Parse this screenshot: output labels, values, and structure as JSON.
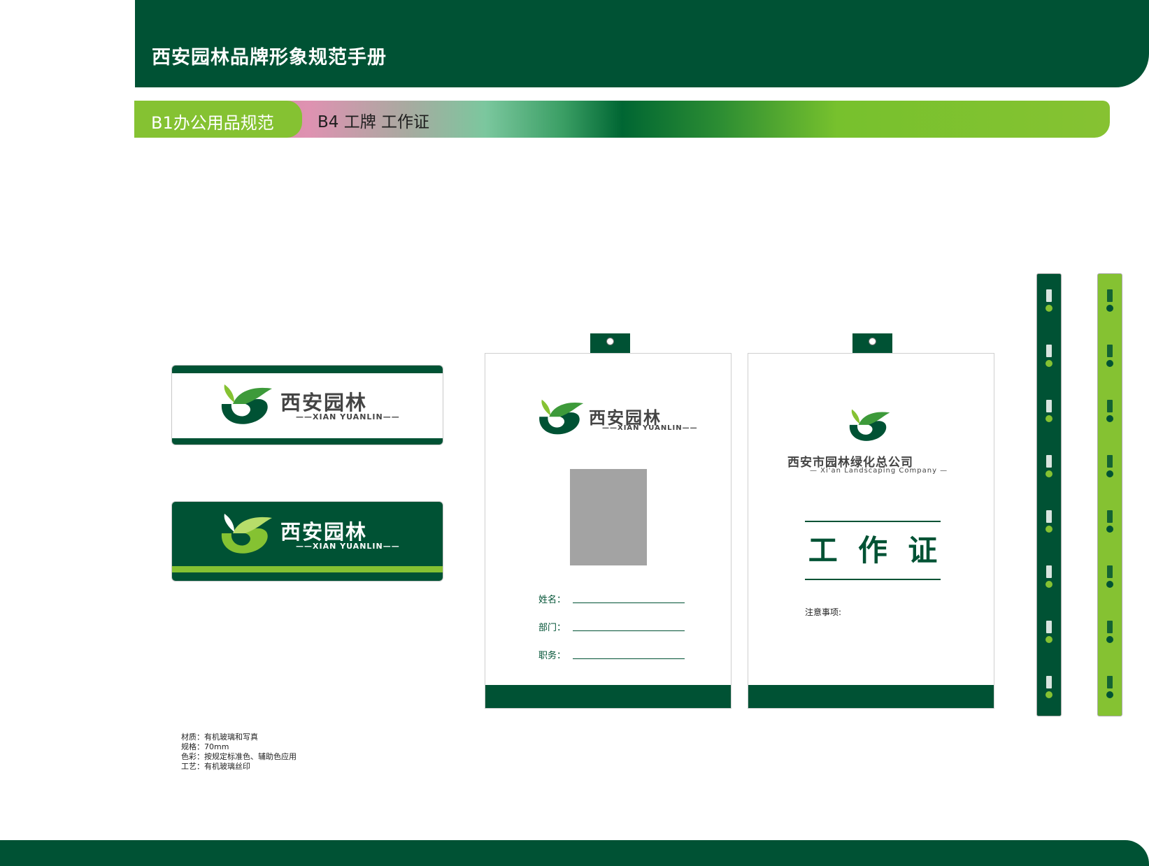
{
  "header": {
    "title": "西安园林品牌形象规范手册"
  },
  "section": {
    "tab": "B1办公用品规范",
    "subtitle": "B4 工牌  工作证"
  },
  "brand": {
    "name_cn": "西安园林",
    "name_en": "XIAN YUANLIN",
    "company_cn": "西安市园林绿化总公司",
    "company_en": "Xi'an Landscaping Company"
  },
  "card_front": {
    "fields": [
      "姓名：",
      "部门：",
      "职务："
    ]
  },
  "card_back": {
    "title": "工  作  证",
    "notice": "注意事项:"
  },
  "notes": [
    "材质：有机玻璃和写真",
    "规格：70mm",
    "色彩：按规定标准色、辅助色应用",
    "工艺：有机玻璃丝印"
  ],
  "colors": {
    "primary": "#005234",
    "accent": "#85c232"
  }
}
